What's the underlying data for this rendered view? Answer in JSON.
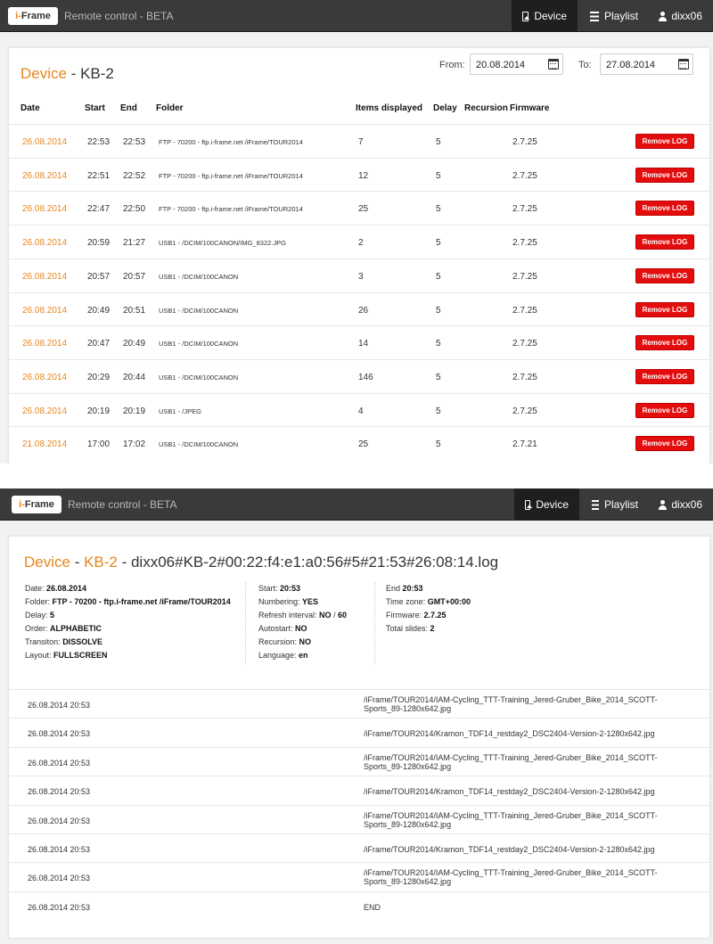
{
  "app": {
    "logo": {
      "prefix": "i-",
      "name": "Frame"
    },
    "title": "Remote control - BETA"
  },
  "nav": {
    "device": "Device",
    "playlist": "Playlist",
    "user": "dixx06"
  },
  "device_page": {
    "title_device": "Device",
    "title_sep": " - ",
    "title_name": "KB-2",
    "from_label": "From:",
    "from_value": "20.08.2014",
    "to_label": "To:",
    "to_value": "27.08.2014",
    "columns": [
      "Date",
      "Start",
      "End",
      "Folder",
      "Items displayed",
      "Delay",
      "Recursion",
      "Firmware"
    ],
    "remove_label": "Remove LOG",
    "rows": [
      {
        "date": "26.08.2014",
        "start": "22:53",
        "end": "22:53",
        "folder": "FTP - 70200 - ftp.i-frame.net /iFrame/TOUR2014",
        "items": "7",
        "delay": "5",
        "firmware": "2.7.25"
      },
      {
        "date": "26.08.2014",
        "start": "22:51",
        "end": "22:52",
        "folder": "FTP - 70200 - ftp.i-frame.net /iFrame/TOUR2014",
        "items": "12",
        "delay": "5",
        "firmware": "2.7.25"
      },
      {
        "date": "26.08.2014",
        "start": "22:47",
        "end": "22:50",
        "folder": "FTP - 70200 - ftp.i-frame.net /iFrame/TOUR2014",
        "items": "25",
        "delay": "5",
        "firmware": "2.7.25"
      },
      {
        "date": "26.08.2014",
        "start": "20:59",
        "end": "21:27",
        "folder": "USB1 - /DCIM/100CANON/IMG_8322.JPG",
        "items": "2",
        "delay": "5",
        "firmware": "2.7.25"
      },
      {
        "date": "26.08.2014",
        "start": "20:57",
        "end": "20:57",
        "folder": "USB1 - /DCIM/100CANON",
        "items": "3",
        "delay": "5",
        "firmware": "2.7.25"
      },
      {
        "date": "26.08.2014",
        "start": "20:49",
        "end": "20:51",
        "folder": "USB1 - /DCIM/100CANON",
        "items": "26",
        "delay": "5",
        "firmware": "2.7.25"
      },
      {
        "date": "26.08.2014",
        "start": "20:47",
        "end": "20:49",
        "folder": "USB1 - /DCIM/100CANON",
        "items": "14",
        "delay": "5",
        "firmware": "2.7.25"
      },
      {
        "date": "26.08.2014",
        "start": "20:29",
        "end": "20:44",
        "folder": "USB1 - /DCIM/100CANON",
        "items": "146",
        "delay": "5",
        "firmware": "2.7.25"
      },
      {
        "date": "26.08.2014",
        "start": "20:19",
        "end": "20:19",
        "folder": "USB1 - /JPEG",
        "items": "4",
        "delay": "5",
        "firmware": "2.7.25"
      },
      {
        "date": "21.08.2014",
        "start": "17:00",
        "end": "17:02",
        "folder": "USB1 - /DCIM/100CANON",
        "items": "25",
        "delay": "5",
        "firmware": "2.7.21"
      }
    ]
  },
  "log_page": {
    "title_device": "Device",
    "title_sep": " - ",
    "title_name": "KB-2",
    "title_file": " - dixx06#KB-2#00:22:f4:e1:a0:56#5#21:53#26:08:14.log",
    "col1": [
      {
        "label": "Date: ",
        "value": "26.08.2014"
      },
      {
        "label": "Folder: ",
        "value": "FTP - 70200 - ftp.i-frame.net /iFrame/TOUR2014"
      },
      {
        "label": "Delay: ",
        "value": "5"
      },
      {
        "label": "Order: ",
        "value": "ALPHABETIC"
      },
      {
        "label": "Transiton: ",
        "value": "DISSOLVE"
      },
      {
        "label": "Layout: ",
        "value": "FULLSCREEN"
      }
    ],
    "col2": [
      {
        "label": "Start: ",
        "value": "20:53"
      },
      {
        "label": "Numbering: ",
        "value": "YES"
      },
      {
        "label": "Refresh interval: ",
        "value": "NO",
        "extra_sep": " / ",
        "extra": "60"
      },
      {
        "label": "Autostart: ",
        "value": "NO"
      },
      {
        "label": "Recursion: ",
        "value": "NO"
      },
      {
        "label": "Language: ",
        "value": "en"
      }
    ],
    "col3": [
      {
        "label": "End ",
        "value": "20:53"
      },
      {
        "label": "Time zone: ",
        "value": "GMT+00:00"
      },
      {
        "label": "Firmware: ",
        "value": "2.7.25"
      },
      {
        "label": "Total slides: ",
        "value": "2"
      }
    ],
    "entries": [
      {
        "time": "26.08.2014 20:53",
        "path": "/iFrame/TOUR2014/IAM-Cycling_TTT-Training_Jered-Gruber_Bike_2014_SCOTT-Sports_89-1280x642.jpg"
      },
      {
        "time": "26.08.2014 20:53",
        "path": "/iFrame/TOUR2014/Kramon_TDF14_restday2_DSC2404-Version-2-1280x642.jpg"
      },
      {
        "time": "26.08.2014 20:53",
        "path": "/iFrame/TOUR2014/IAM-Cycling_TTT-Training_Jered-Gruber_Bike_2014_SCOTT-Sports_89-1280x642.jpg"
      },
      {
        "time": "26.08.2014 20:53",
        "path": "/iFrame/TOUR2014/Kramon_TDF14_restday2_DSC2404-Version-2-1280x642.jpg"
      },
      {
        "time": "26.08.2014 20:53",
        "path": "/iFrame/TOUR2014/IAM-Cycling_TTT-Training_Jered-Gruber_Bike_2014_SCOTT-Sports_89-1280x642.jpg"
      },
      {
        "time": "26.08.2014 20:53",
        "path": "/iFrame/TOUR2014/Kramon_TDF14_restday2_DSC2404-Version-2-1280x642.jpg"
      },
      {
        "time": "26.08.2014 20:53",
        "path": "/iFrame/TOUR2014/IAM-Cycling_TTT-Training_Jered-Gruber_Bike_2014_SCOTT-Sports_89-1280x642.jpg"
      },
      {
        "time": "26.08.2014 20:53",
        "path": "END"
      }
    ]
  },
  "colors": {
    "accent": "#e8851d",
    "navbar": "#3a3a3a",
    "danger": "#e40d0d"
  }
}
